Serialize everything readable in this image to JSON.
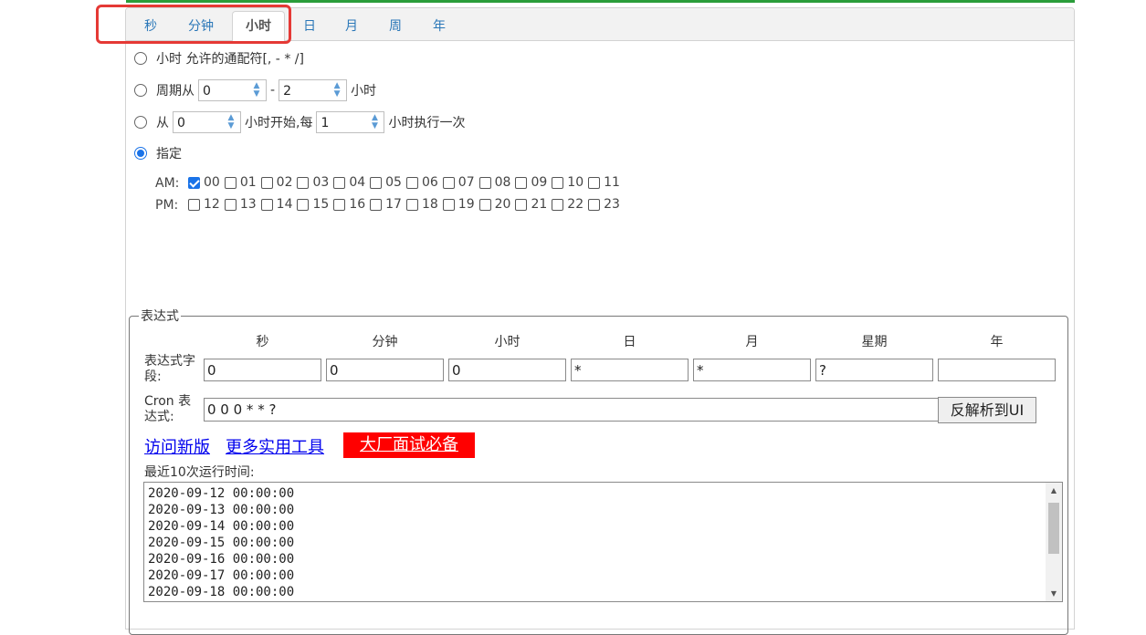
{
  "tabs": [
    {
      "label": "秒",
      "active": false
    },
    {
      "label": "分钟",
      "active": false
    },
    {
      "label": "小时",
      "active": true
    },
    {
      "label": "日",
      "active": false
    },
    {
      "label": "月",
      "active": false
    },
    {
      "label": "周",
      "active": false
    },
    {
      "label": "年",
      "active": false
    }
  ],
  "options": {
    "wildcard_label": "小时 允许的通配符[, - * /]",
    "cycle_label": "周期从",
    "cycle_from": "0",
    "cycle_sep": "-",
    "cycle_to": "2",
    "cycle_suffix": "小时",
    "from_label": "从",
    "from_value": "0",
    "from_mid": "小时开始,每",
    "every_value": "1",
    "every_suffix": "小时执行一次",
    "specify_label": "指定"
  },
  "hours": {
    "am_label": "AM:",
    "pm_label": "PM:",
    "am": [
      "00",
      "01",
      "02",
      "03",
      "04",
      "05",
      "06",
      "07",
      "08",
      "09",
      "10",
      "11"
    ],
    "pm": [
      "12",
      "13",
      "14",
      "15",
      "16",
      "17",
      "18",
      "19",
      "20",
      "21",
      "22",
      "23"
    ],
    "checked": [
      "00"
    ]
  },
  "expression": {
    "legend": "表达式",
    "columns": [
      "秒",
      "分钟",
      "小时",
      "日",
      "月",
      "星期",
      "年"
    ],
    "field_label": "表达式字段:",
    "field_values": [
      "0",
      "0",
      "0",
      "*",
      "*",
      "?",
      ""
    ],
    "cron_label": "Cron 表达式:",
    "cron_value": "0 0 0 * * ?",
    "parse_button": "反解析到UI"
  },
  "links": {
    "new_version": "访问新版",
    "more_tools": "更多实用工具",
    "interview": "大厂面试必备"
  },
  "runs": {
    "label": "最近10次运行时间:",
    "times": [
      "2020-09-12 00:00:00",
      "2020-09-13 00:00:00",
      "2020-09-14 00:00:00",
      "2020-09-15 00:00:00",
      "2020-09-16 00:00:00",
      "2020-09-17 00:00:00",
      "2020-09-18 00:00:00"
    ]
  },
  "colors": {
    "accent": "#1a73e8",
    "tab_text": "#2a77b8",
    "highlight": "#e53935",
    "red_button": "#ff0000",
    "top_line": "#2a9d3a"
  }
}
